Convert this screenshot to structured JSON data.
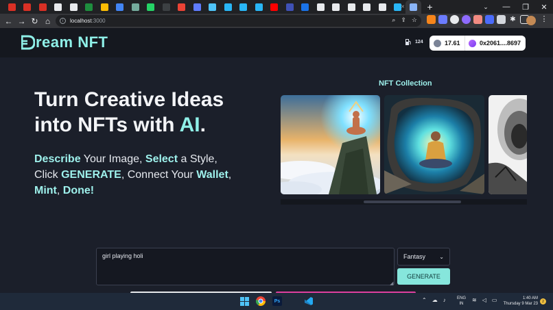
{
  "browser": {
    "tab_favicons": [
      {
        "name": "gmail-tab-1",
        "color": "#d93025"
      },
      {
        "name": "gmail-tab-2",
        "color": "#d93025"
      },
      {
        "name": "gmail-tab-3",
        "color": "#d93025"
      },
      {
        "name": "github-tab-1",
        "color": "#e8eaed"
      },
      {
        "name": "github-tab-2",
        "color": "#e8eaed"
      },
      {
        "name": "sheets-tab",
        "color": "#1e8e3e"
      },
      {
        "name": "drive-tab",
        "color": "#fbbc04"
      },
      {
        "name": "link-tab",
        "color": "#4285f4"
      },
      {
        "name": "chatgpt-tab",
        "color": "#74aa9c"
      },
      {
        "name": "whatsapp-tab",
        "color": "#25d366"
      },
      {
        "name": "dark-tab",
        "color": "#3c4043"
      },
      {
        "name": "record-tab",
        "color": "#ea4335"
      },
      {
        "name": "web3-tab",
        "color": "#5f7cff"
      },
      {
        "name": "vercel-tab",
        "color": "#4fc3f7"
      },
      {
        "name": "cloud-tab-1",
        "color": "#29b6f6"
      },
      {
        "name": "cloud-tab-2",
        "color": "#29b6f6"
      },
      {
        "name": "cloud-tab-3",
        "color": "#29b6f6"
      },
      {
        "name": "youtube-tab",
        "color": "#ff0000"
      },
      {
        "name": "blue-tab-1",
        "color": "#3f51b5"
      },
      {
        "name": "blue-tab-2",
        "color": "#1a73e8"
      },
      {
        "name": "openai-tab",
        "color": "#e8eaed"
      },
      {
        "name": "github-tab-3",
        "color": "#e8eaed"
      },
      {
        "name": "github-tab-4",
        "color": "#e8eaed"
      },
      {
        "name": "app-tab",
        "color": "#e8eaed"
      },
      {
        "name": "google-tab",
        "color": "#e8eaed"
      },
      {
        "name": "localhost-tab",
        "color": "#29b6f6"
      },
      {
        "name": "dream-tab",
        "color": "#8ab4f8"
      }
    ],
    "url_host": "localhost",
    "url_port": ":3000"
  },
  "header": {
    "brand_text": "ream NFT",
    "gas_value": "124",
    "balance": "17.61",
    "address": "0x2061....8697"
  },
  "hero": {
    "title_line1": "Turn Creative Ideas",
    "title_line2_prefix": "into NFTs with ",
    "title_ai": "AI",
    "title_dot": ".",
    "sub": {
      "w1": "Describe",
      "t1": " Your Image, ",
      "w2": "Select",
      "t2": " a Style, Click ",
      "w3": "GENERATE",
      "t3": ", Connect Your ",
      "w4": "Wallet",
      "t4": ", ",
      "w5": "Mint",
      "t5": ", ",
      "w6": "Done!"
    }
  },
  "collection": {
    "title": "NFT Collection"
  },
  "form": {
    "prompt_value": "girl playing holi",
    "style_value": "Fantasy",
    "generate_label": "GENERATE"
  },
  "taskbar": {
    "lang_line1": "ENG",
    "lang_line2": "IN",
    "time": "1:40 AM",
    "date": "Thursday 9 Mar 23",
    "notif_count": "2"
  }
}
